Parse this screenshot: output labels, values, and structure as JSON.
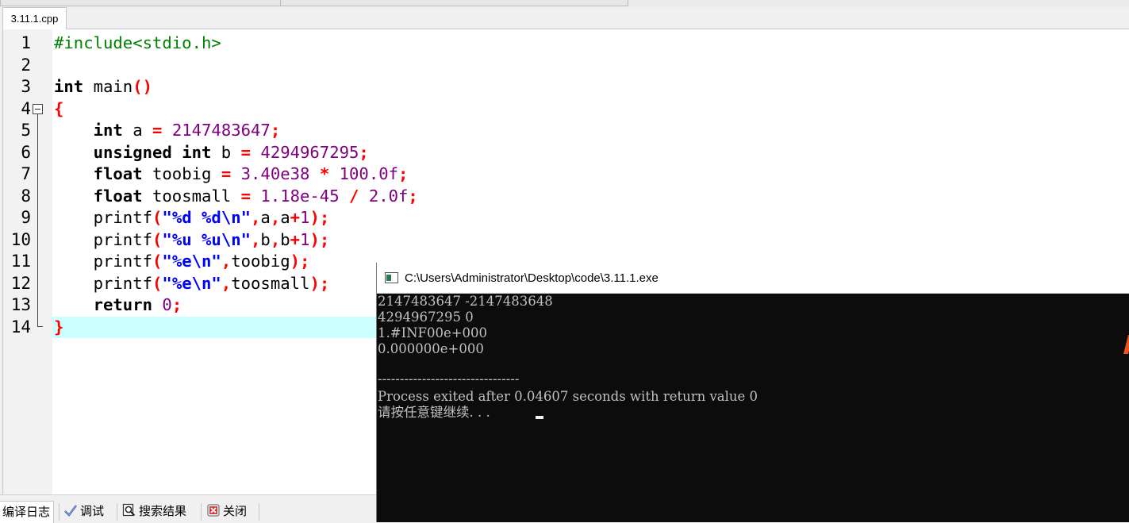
{
  "editor": {
    "tab_label": "3.11.1.cpp",
    "line_numbers": [
      "1",
      "2",
      "3",
      "4",
      "5",
      "6",
      "7",
      "8",
      "9",
      "10",
      "11",
      "12",
      "13",
      "14"
    ],
    "code": {
      "l1": "#include<stdio.h>",
      "l3_kw": "int",
      "l3_rest": " main",
      "l3_paren": "()",
      "l4": "{",
      "l5_kw": "int",
      "l5_var": " a ",
      "l5_eq": "=",
      "l5_num": " 2147483647",
      "l5_semi": ";",
      "l6_kw": "unsigned int",
      "l6_var": " b ",
      "l6_eq": "=",
      "l6_num": " 4294967295",
      "l6_semi": ";",
      "l7_kw": "float",
      "l7_var": " toobig ",
      "l7_eq": "=",
      "l7_num1": " 3.40e38 ",
      "l7_op": "*",
      "l7_num2": " 100.0f",
      "l7_semi": ";",
      "l8_kw": "float",
      "l8_var": " toosmall ",
      "l8_eq": "=",
      "l8_num1": " 1.18e-45 ",
      "l8_op": "/",
      "l8_num2": " 2.0f",
      "l8_semi": ";",
      "l9_fn": "printf",
      "l9_open": "(",
      "l9_str": "\"%d %d\\n\"",
      "l9_c1": ",",
      "l9_a1": "a",
      "l9_c2": ",",
      "l9_a2": "a",
      "l9_plus": "+",
      "l9_one": "1",
      "l9_close": ");",
      "l10_fn": "printf",
      "l10_open": "(",
      "l10_str": "\"%u %u\\n\"",
      "l10_c1": ",",
      "l10_a1": "b",
      "l10_c2": ",",
      "l10_a2": "b",
      "l10_plus": "+",
      "l10_one": "1",
      "l10_close": ");",
      "l11_fn": "printf",
      "l11_open": "(",
      "l11_str": "\"%e\\n\"",
      "l11_c1": ",",
      "l11_a1": "toobig",
      "l11_close": ");",
      "l12_fn": "printf",
      "l12_open": "(",
      "l12_str": "\"%e\\n\"",
      "l12_c1": ",",
      "l12_a1": "toosmall",
      "l12_close": ");",
      "l13_kw": "return",
      "l13_num": " 0",
      "l13_semi": ";",
      "l14": "}"
    }
  },
  "bottom_tabs": {
    "compile_log": "编译日志",
    "debug": "调试",
    "search_results": "搜索结果",
    "close": "关闭"
  },
  "console": {
    "title": "C:\\Users\\Administrator\\Desktop\\code\\3.11.1.exe",
    "lines": [
      "2147483647 -2147483648",
      "4294967295 0",
      "1.#INF00e+000",
      "0.000000e+000",
      "",
      "--------------------------------",
      "Process exited after 0.04607 seconds with return value 0",
      "请按任意键继续. . . "
    ]
  },
  "colors": {
    "preprocessor": "#008000",
    "keyword": "#000000",
    "symbol": "#ff0000",
    "number": "#800080",
    "string": "#0000ff",
    "current_line": "#ccffff",
    "console_bg": "#0c0c0c",
    "console_text": "#c0c0c0"
  }
}
